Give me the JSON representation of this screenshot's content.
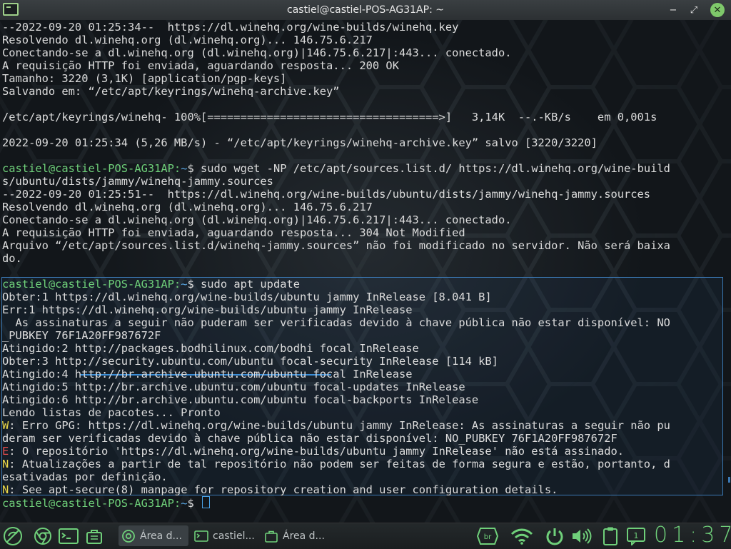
{
  "window": {
    "title": "castiel@castiel-POS-AG31AP: ~",
    "minimize_glyph": "−",
    "maximize_glyph": "⤢",
    "close_glyph": "✕"
  },
  "terminal": {
    "lines": [
      {
        "type": "plain",
        "text": "--2022-09-20 01:25:34--  https://dl.winehq.org/wine-builds/winehq.key"
      },
      {
        "type": "plain",
        "text": "Resolvendo dl.winehq.org (dl.winehq.org)... 146.75.6.217"
      },
      {
        "type": "plain",
        "text": "Conectando-se a dl.winehq.org (dl.winehq.org)|146.75.6.217|:443... conectado."
      },
      {
        "type": "plain",
        "text": "A requisição HTTP foi enviada, aguardando resposta... 200 OK"
      },
      {
        "type": "plain",
        "text": "Tamanho: 3220 (3,1K) [application/pgp-keys]"
      },
      {
        "type": "plain",
        "text": "Salvando em: “/etc/apt/keyrings/winehq-archive.key”"
      },
      {
        "type": "plain",
        "text": ""
      },
      {
        "type": "plain",
        "text": "/etc/apt/keyrings/winehq- 100%[===================================>]   3,14K  --.-KB/s    em 0,001s"
      },
      {
        "type": "plain",
        "text": ""
      },
      {
        "type": "plain",
        "text": "2022-09-20 01:25:34 (5,26 MB/s) - “/etc/apt/keyrings/winehq-archive.key” salvo [3220/3220]"
      },
      {
        "type": "plain",
        "text": ""
      },
      {
        "type": "prompt",
        "user": "castiel@castiel-POS-AG31AP:",
        "path": "~",
        "sym": "$ ",
        "cmd": "sudo wget -NP /etc/apt/sources.list.d/ https://dl.winehq.org/wine-build"
      },
      {
        "type": "plain",
        "text": "s/ubuntu/dists/jammy/winehq-jammy.sources"
      },
      {
        "type": "plain",
        "text": "--2022-09-20 01:25:51--  https://dl.winehq.org/wine-builds/ubuntu/dists/jammy/winehq-jammy.sources"
      },
      {
        "type": "plain",
        "text": "Resolvendo dl.winehq.org (dl.winehq.org)... 146.75.6.217"
      },
      {
        "type": "plain",
        "text": "Conectando-se a dl.winehq.org (dl.winehq.org)|146.75.6.217|:443... conectado."
      },
      {
        "type": "plain",
        "text": "A requisição HTTP foi enviada, aguardando resposta... 304 Not Modified"
      },
      {
        "type": "plain",
        "text": "Arquivo “/etc/apt/sources.list.d/winehq-jammy.sources” não foi modificado no servidor. Não será baixa"
      },
      {
        "type": "plain",
        "text": "do."
      },
      {
        "type": "plain",
        "text": ""
      },
      {
        "type": "prompt",
        "user": "castiel@castiel-POS-AG31AP:",
        "path": "~",
        "sym": "$ ",
        "cmd": "sudo apt update"
      },
      {
        "type": "plain",
        "text": "Obter:1 https://dl.winehq.org/wine-builds/ubuntu jammy InRelease [8.041 B]"
      },
      {
        "type": "plain",
        "text": "Err:1 https://dl.winehq.org/wine-builds/ubuntu jammy InRelease"
      },
      {
        "type": "plain",
        "text": "  As assinaturas a seguir não puderam ser verificadas devido à chave pública não estar disponível: NO"
      },
      {
        "type": "plain",
        "text": "_PUBKEY 76F1A20FF987672F"
      },
      {
        "type": "plain",
        "text": "Atingido:2 http://packages.bodhilinux.com/bodhi focal InRelease"
      },
      {
        "type": "plain",
        "text": "Obter:3 http://security.ubuntu.com/ubuntu focal-security InRelease [114 kB]"
      },
      {
        "type": "plain",
        "text": "Atingido:4 http://br.archive.ubuntu.com/ubuntu focal InRelease"
      },
      {
        "type": "plain",
        "text": "Atingido:5 http://br.archive.ubuntu.com/ubuntu focal-updates InRelease"
      },
      {
        "type": "plain",
        "text": "Atingido:6 http://br.archive.ubuntu.com/ubuntu focal-backports InRelease"
      },
      {
        "type": "plain",
        "text": "Lendo listas de pacotes... Pronto"
      },
      {
        "type": "tagged",
        "tag": "W",
        "tagclass": "warnW",
        "text": ": Erro GPG: https://dl.winehq.org/wine-builds/ubuntu jammy InRelease: As assinaturas a seguir não pu"
      },
      {
        "type": "plain",
        "text": "deram ser verificadas devido à chave pública não estar disponível: NO_PUBKEY 76F1A20FF987672F"
      },
      {
        "type": "tagged",
        "tag": "E",
        "tagclass": "errE",
        "text": ": O repositório 'https://dl.winehq.org/wine-builds/ubuntu jammy InRelease' não está assinado."
      },
      {
        "type": "tagged",
        "tag": "N",
        "tagclass": "noteN",
        "text": ": Atualizações a partir de tal repositório não podem ser feitas de forma segura e estão, portanto, d"
      },
      {
        "type": "plain",
        "text": "esativadas por definição."
      },
      {
        "type": "tagged",
        "tag": "N",
        "tagclass": "noteN",
        "text": ": See apt-secure(8) manpage for repository creation and user configuration details."
      },
      {
        "type": "prompt",
        "user": "castiel@castiel-POS-AG31AP:",
        "path": "~",
        "sym": "$ ",
        "cmd": "",
        "cursor": true
      }
    ]
  },
  "taskbar": {
    "launchers": [
      {
        "name": "bodhi-menu-icon"
      },
      {
        "name": "chrome-launcher-icon"
      },
      {
        "name": "terminal-launcher-icon"
      },
      {
        "name": "bag-launcher-icon"
      }
    ],
    "tasks": [
      {
        "name": "task-area-de-trabalho-1",
        "label": "Área d...",
        "icon": "chrome",
        "active": true
      },
      {
        "name": "task-terminal",
        "label": "castiel...",
        "icon": "terminal",
        "active": false
      },
      {
        "name": "task-area-de-trabalho-2",
        "label": "Área d...",
        "icon": "bag",
        "active": false
      }
    ],
    "tray": {
      "keyboard_layout": "br",
      "notification_count": "1"
    },
    "clock": "01:37",
    "accent": "#6fd07a"
  }
}
